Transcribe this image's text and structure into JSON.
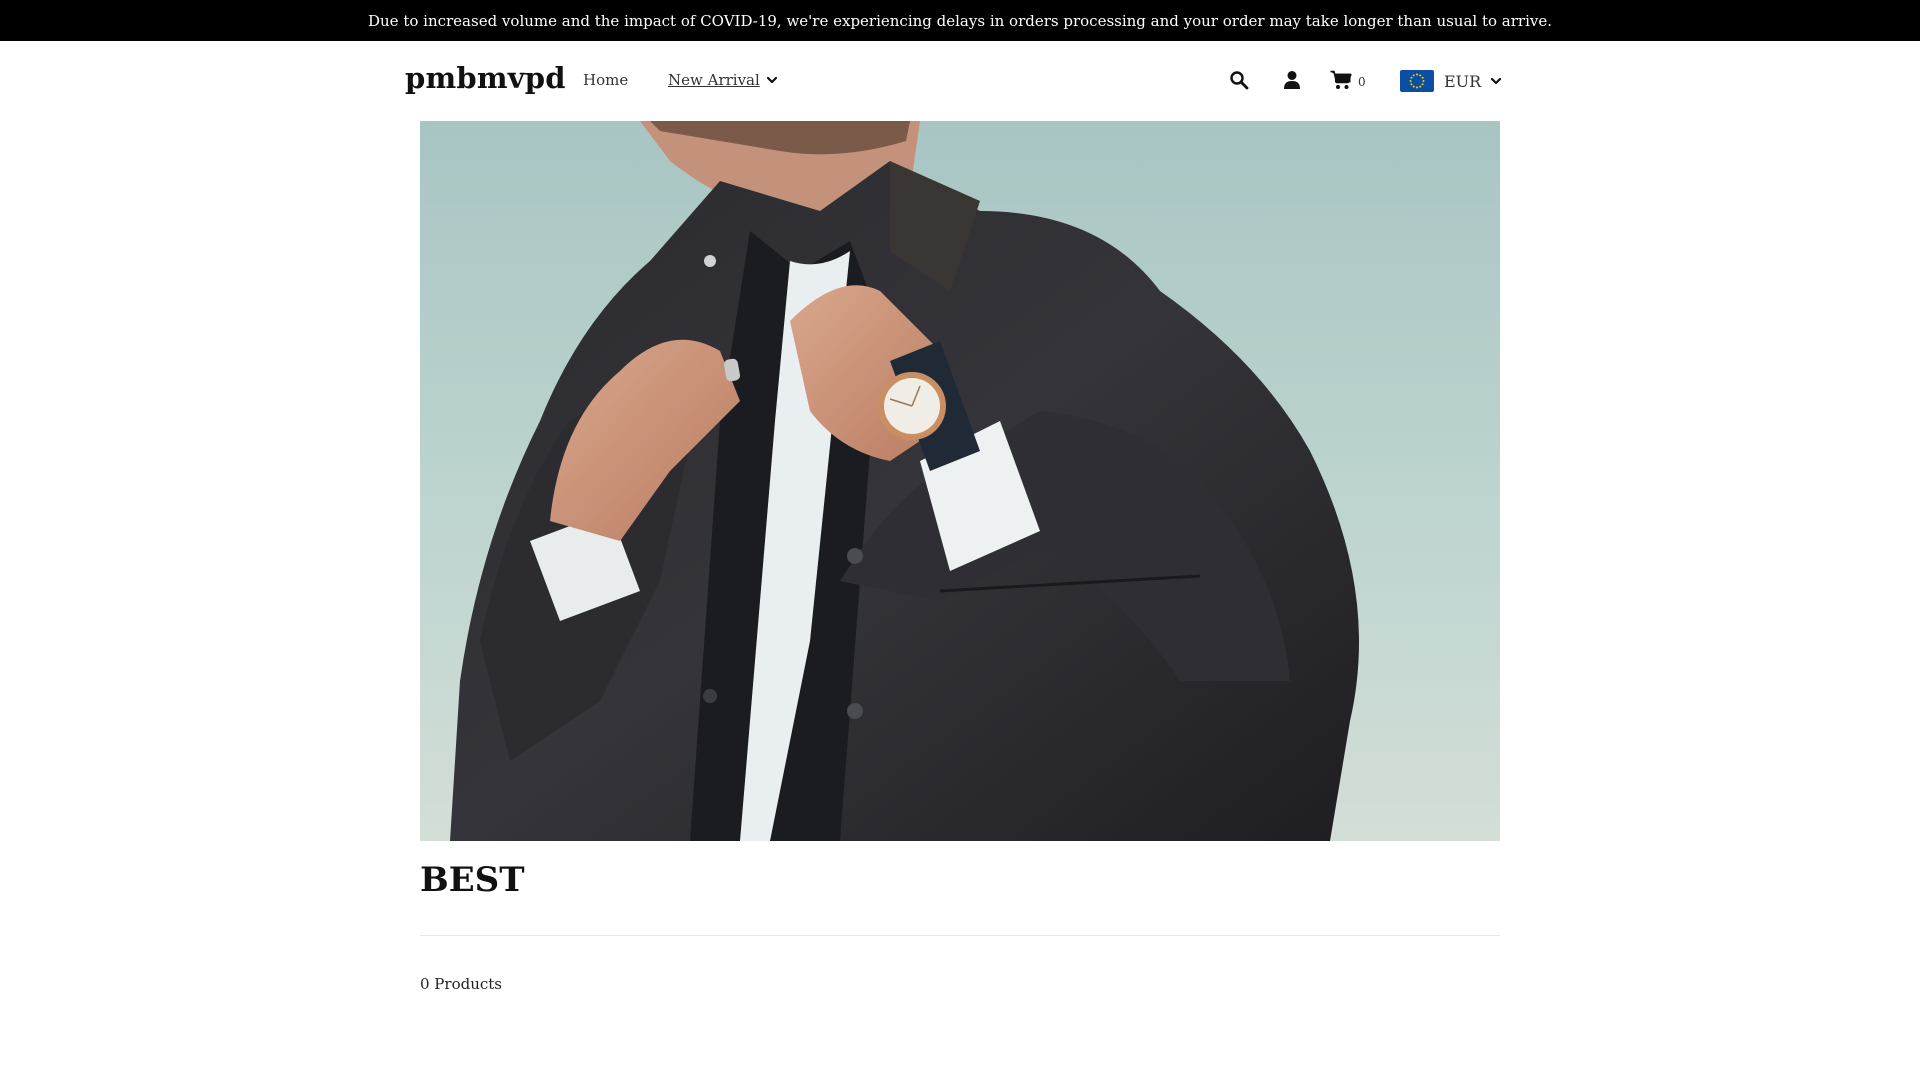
{
  "announcement": {
    "text": "Due to increased volume and the impact of COVID-19, we're experiencing delays in orders processing and your order may take longer than usual to arrive."
  },
  "header": {
    "logo": "pmbmvpd",
    "nav": {
      "home": "Home",
      "new_arrival": "New Arrival"
    },
    "icons": {
      "search": "search-icon",
      "account": "user-icon",
      "cart": "cart-icon",
      "dropdown": "chevron-down-icon",
      "flag": "eu-flag-icon"
    },
    "cart_count": "0",
    "currency": "EUR"
  },
  "hero": {
    "image": "man-in-dark-jacket-wearing-watch"
  },
  "collection": {
    "title": "BEST",
    "product_count": "0 Products"
  },
  "colors": {
    "announcement_bg": "#000000",
    "announcement_text": "#ffffff",
    "flag_blue": "#0b4ea2",
    "flag_stars": "#f5d400",
    "sky": "#b7cfcc",
    "jacket": "#26262a"
  }
}
